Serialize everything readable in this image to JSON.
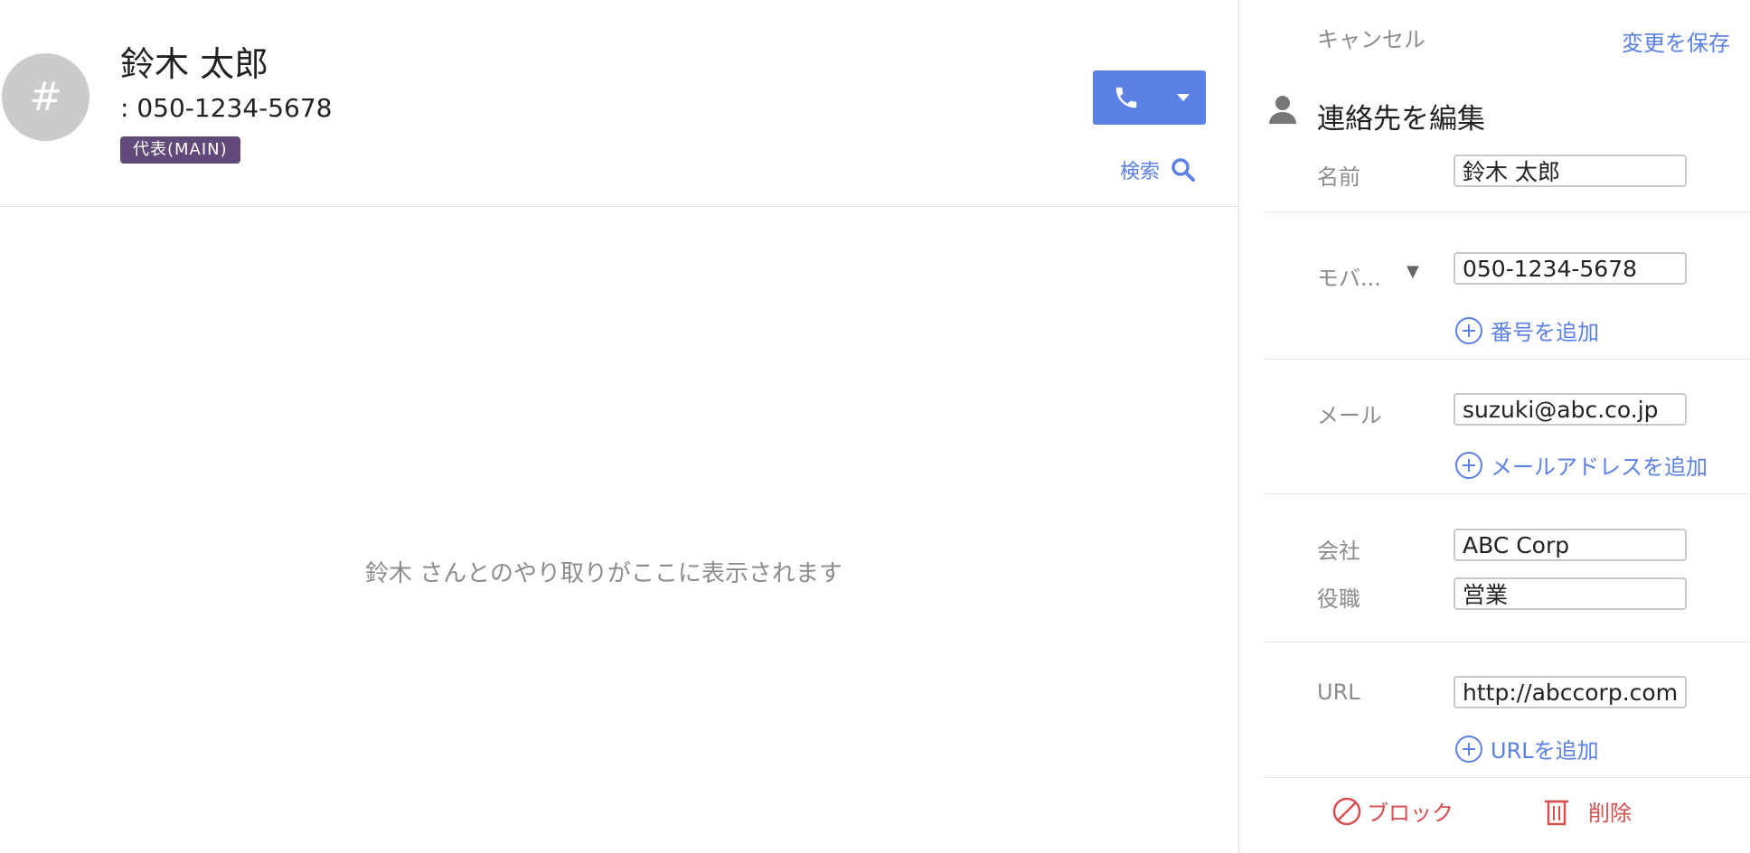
{
  "contact": {
    "avatar_initial": "#",
    "name": "鈴木 太郎",
    "phone": ": 050-1234-5678",
    "badge": "代表(MAIN)"
  },
  "actions": {
    "search_label": "検索"
  },
  "conversation": {
    "empty_message": "鈴木 さんとのやり取りがここに表示されます"
  },
  "edit_panel": {
    "cancel": "キャンセル",
    "save": "変更を保存",
    "title": "連絡先を編集",
    "name_label": "名前",
    "name_value": "鈴木 太郎",
    "phone_type_label": "モバ...",
    "phone_value": "050-1234-5678",
    "add_phone": "番号を追加",
    "email_label": "メール",
    "email_value": "suzuki@abc.co.jp",
    "add_email": "メールアドレスを追加",
    "company_label": "会社",
    "company_value": "ABC Corp",
    "title_label": "役職",
    "title_value": "営業",
    "url_label": "URL",
    "url_value": "http://abccorp.com",
    "add_url": "URLを追加",
    "block": "ブロック",
    "delete": "削除"
  },
  "colors": {
    "accent": "#5b80e6",
    "badge": "#614a7a",
    "danger": "#d94f4f",
    "muted": "#8c8c8c",
    "avatar": "#cbcbcb"
  },
  "icons": [
    "phone-icon",
    "chevron-down-icon",
    "search-icon",
    "person-icon",
    "add-circle-icon",
    "block-icon",
    "trash-icon"
  ]
}
